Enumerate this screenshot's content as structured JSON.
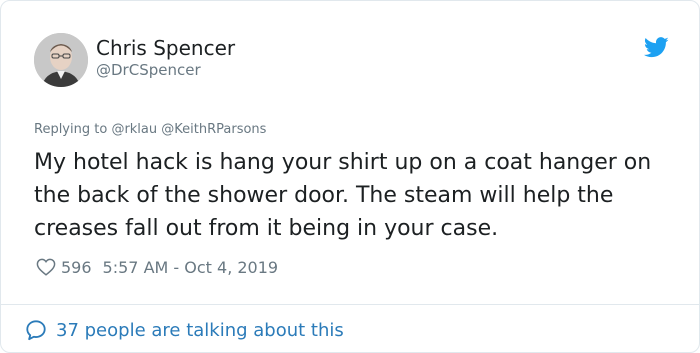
{
  "author": {
    "name": "Chris Spencer",
    "handle": "@DrCSpencer"
  },
  "reply": {
    "prefix": "Replying to",
    "mentions": [
      "@rklau",
      "@KeithRParsons"
    ]
  },
  "tweet": {
    "text": "My hotel hack is hang your shirt up on a coat hanger on the back of the shower door. The steam will help the creases fall out from it being in your case."
  },
  "meta": {
    "likes": "596",
    "timestamp": "5:57 AM - Oct 4, 2019"
  },
  "footer": {
    "conversation_label": "37 people are talking about this"
  },
  "icons": {
    "brand": "twitter-bird-icon",
    "like": "heart-icon",
    "conversation": "speech-bubble-icon"
  },
  "colors": {
    "brand_blue": "#1da1f2",
    "link_blue": "#2b7bb9",
    "secondary_text": "#697882",
    "primary_text": "#1c2022",
    "border": "#e1e8ed"
  }
}
